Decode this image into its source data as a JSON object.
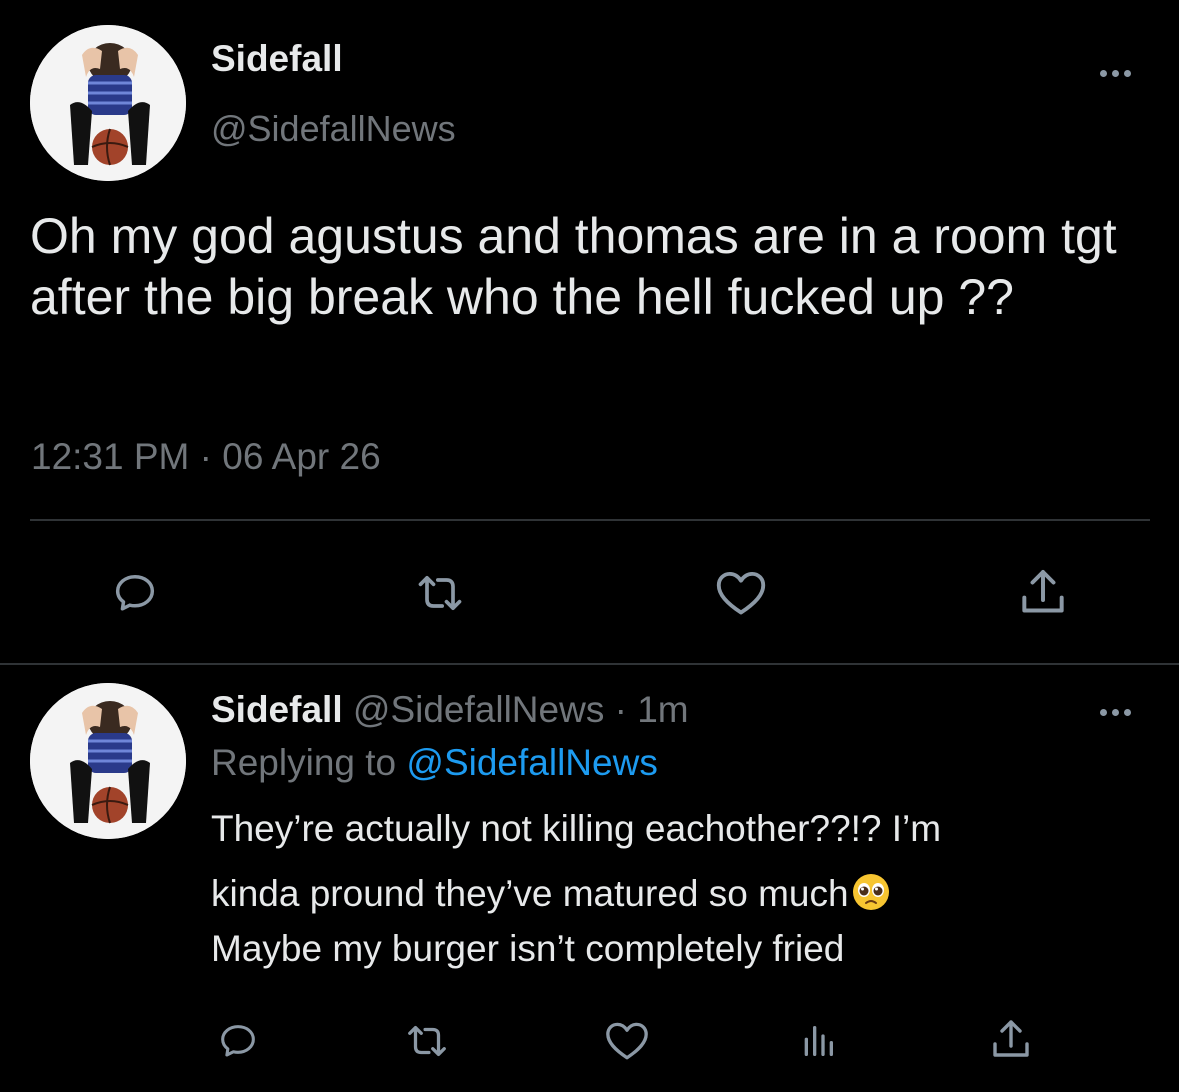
{
  "main_tweet": {
    "display_name": "Sidefall",
    "handle": "@SidefallNews",
    "text": "Oh my god agustus and thomas are in a room tgt after the big break who the hell fucked up ??",
    "timestamp": "12:31 PM · 06 Apr 26",
    "actions": [
      "reply-icon",
      "retweet-icon",
      "like-icon",
      "share-icon"
    ]
  },
  "reply_tweet": {
    "display_name": "Sidefall",
    "meta": "@SidefallNews · 1m",
    "replying_prefix": "Replying to ",
    "replying_handle": "@SidefallNews",
    "lines": [
      "They’re actually not killing eachother??!? I’m",
      "kinda pround they’ve matured so much",
      "Maybe my burger isn’t completely fried"
    ],
    "emoji": "pleading-face-emoji",
    "actions": [
      "reply-icon",
      "retweet-icon",
      "like-icon",
      "analytics-icon",
      "share-icon"
    ]
  },
  "colors": {
    "background": "#000000",
    "primary_text": "#e7e9ea",
    "secondary_text": "#71767b",
    "link": "#1d9bf0",
    "icon": "#8b98a5",
    "divider": "#2f3336"
  }
}
